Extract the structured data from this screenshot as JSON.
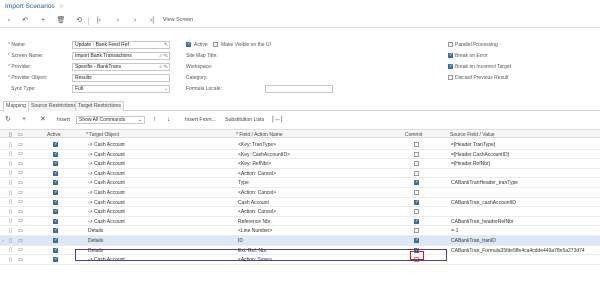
{
  "title": "Import Scenarios",
  "toolbar": {
    "view_screen": "View Screen"
  },
  "form": {
    "name_label": "Name:",
    "name_value": "Update - Bank Feed Ref",
    "screen_name_label": "Screen Name:",
    "screen_name_value": "Import Bank Transactions",
    "provider_label": "Provider:",
    "provider_value": "Specifix - BankTrans",
    "provider_object_label": "Provider Object:",
    "provider_object_value": "Results",
    "sync_type_label": "Sync Type:",
    "sync_type_value": "Full",
    "active_label": "Active",
    "visible_label": "Make Visible on the UI",
    "site_map_title_label": "Site Map Title:",
    "workspace_label": "Workspace:",
    "category_label": "Category:",
    "formula_locale_label": "Formula Locale:",
    "parallel_label": "Parallel Processing",
    "break_error_label": "Break on Error",
    "break_target_label": "Break on Incorrect Target",
    "discard_label": "Discard Previous Result"
  },
  "tabs": [
    "Mapping",
    "Source Restrictions",
    "Target Restrictions"
  ],
  "grid_toolbar": {
    "insert": "Insert",
    "show_all": "Show All Commands",
    "insert_from": "Insert From...",
    "substitution": "Substitution Lists"
  },
  "columns": {
    "active": "Active",
    "target_object": "* Target Object",
    "field_action": "* Field / Action Name",
    "commit": "Commit",
    "source_field": "Source Field / Value"
  },
  "rows": [
    {
      "target": "-> Cash Account",
      "field": "<Key: TranType>",
      "commit": false,
      "source": "=[Header.TranType]"
    },
    {
      "target": "-> Cash Account",
      "field": "<Key: CashAccountID>",
      "commit": false,
      "source": "=[Header.CashAccountID]"
    },
    {
      "target": "-> Cash Account",
      "field": "<Key: RefNbr>",
      "commit": false,
      "source": "=[Header.RefNbr]"
    },
    {
      "target": "-> Cash Account",
      "field": "<Action: Cancel>",
      "commit": false,
      "source": ""
    },
    {
      "target": "-> Cash Account",
      "field": "Type",
      "commit": true,
      "source": "CABankTranHeader_tranType"
    },
    {
      "target": "-> Cash Account",
      "field": "<Action: Cancel>",
      "commit": false,
      "source": ""
    },
    {
      "target": "-> Cash Account",
      "field": "Cash Account",
      "commit": true,
      "source": "CABankTran_cashAccountID"
    },
    {
      "target": "-> Cash Account",
      "field": "<Action: Cancel>",
      "commit": false,
      "source": ""
    },
    {
      "target": "-> Cash Account",
      "field": "Reference Nbr.",
      "commit": true,
      "source": "CABankTran_headerRefNbr"
    },
    {
      "target": "Details",
      "field": "<Line Number>",
      "commit": false,
      "source": "=-1"
    },
    {
      "target": "Details",
      "field": "ID",
      "commit": true,
      "source": "CABankTran_tranID"
    },
    {
      "target": "Details",
      "field": "Ext. Ref. Nbr.",
      "commit": true,
      "source": "CABankTran_Formula35fde5ffe4ca4cdde449a78e5a273d74"
    },
    {
      "target": "-> Cash Account",
      "field": "<Action: Save>",
      "commit": false,
      "source": ""
    }
  ]
}
